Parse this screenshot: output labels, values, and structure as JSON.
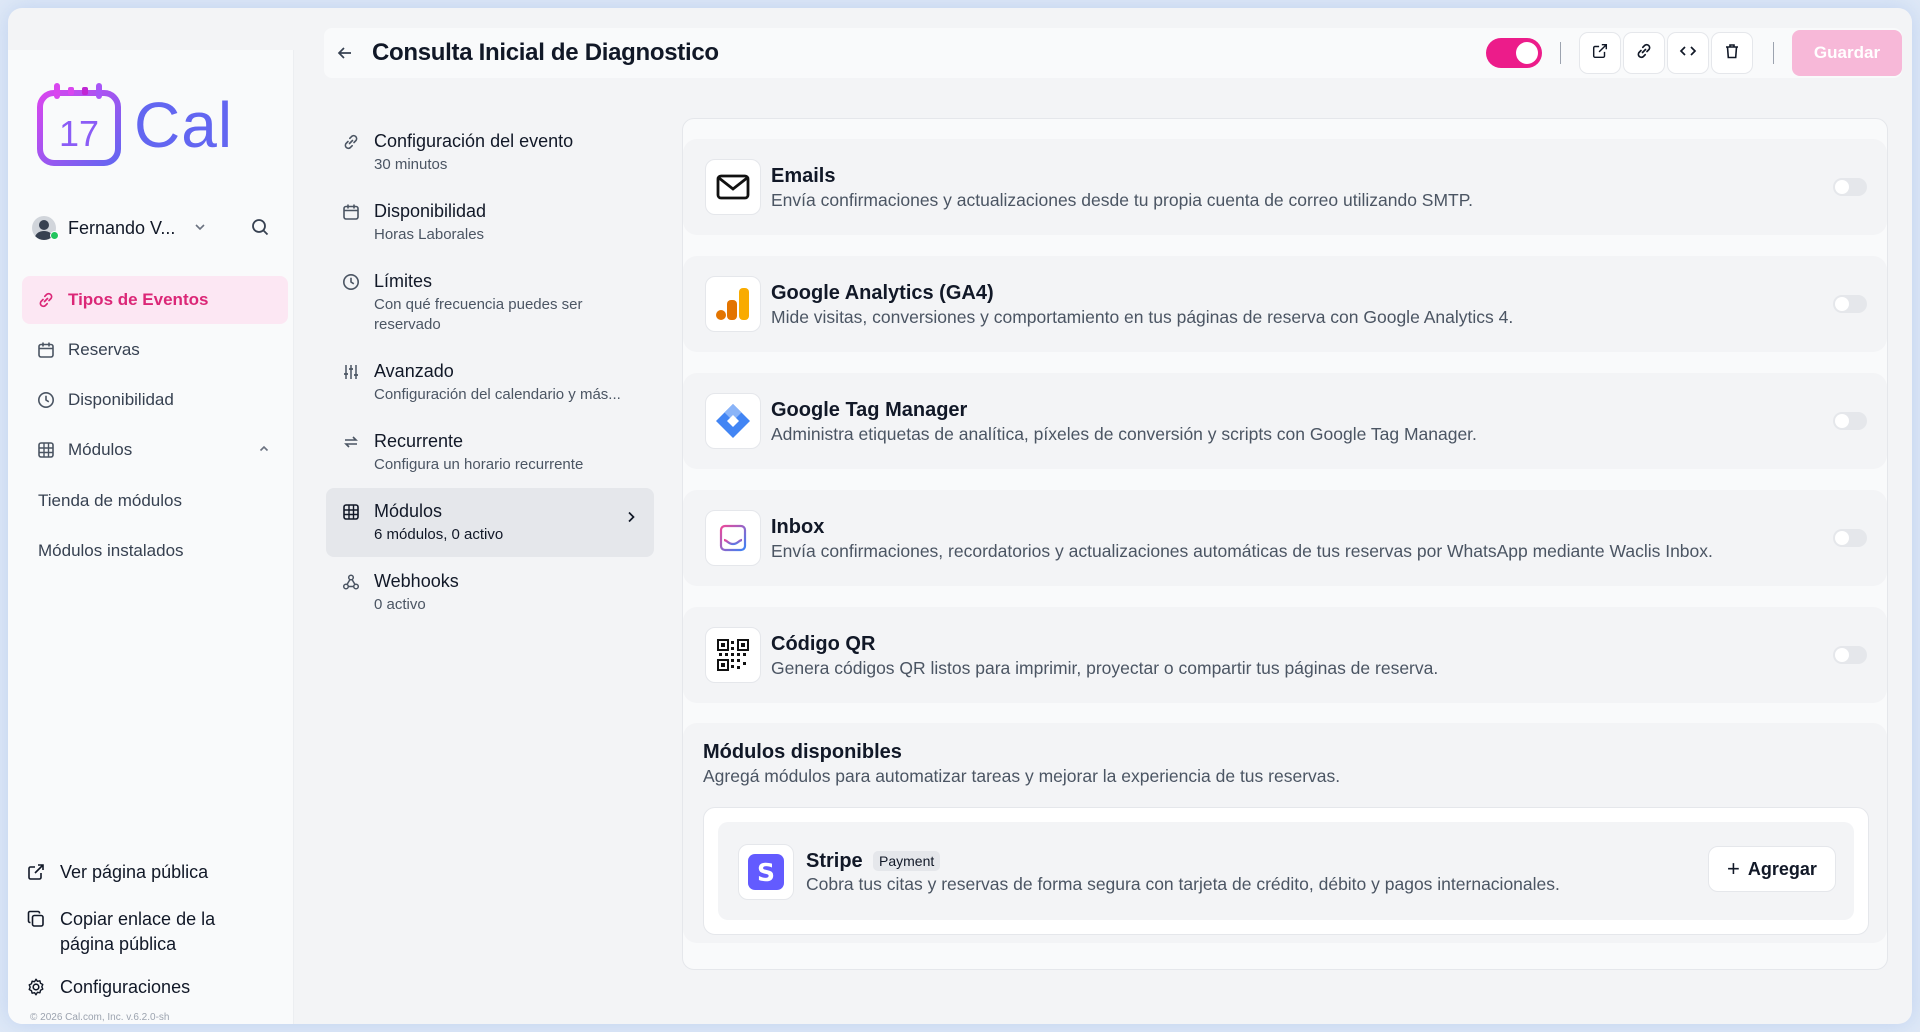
{
  "app": {
    "logo_text": "Cal",
    "logo_day": "17"
  },
  "user": {
    "name": "Fernando V..."
  },
  "sidebar": {
    "items": [
      {
        "label": "Tipos de Eventos",
        "icon": "link-icon",
        "active": true
      },
      {
        "label": "Reservas",
        "icon": "calendar-icon"
      },
      {
        "label": "Disponibilidad",
        "icon": "clock-icon"
      },
      {
        "label": "Módulos",
        "icon": "grid-icon"
      }
    ],
    "sub_items": [
      "Tienda de módulos",
      "Módulos instalados"
    ],
    "bottom": [
      {
        "label": "Ver página pública",
        "icon": "external-link-icon"
      },
      {
        "label": "Copiar enlace de la página pública",
        "icon": "copy-icon"
      },
      {
        "label": "Configuraciones",
        "icon": "gear-icon"
      }
    ],
    "copyright": "© 2026 Cal.com, Inc. v.6.2.0-sh"
  },
  "header": {
    "title": "Consulta Inicial de Diagnostico",
    "save_label": "Guardar",
    "event_enabled": true
  },
  "subnav": [
    {
      "title": "Configuración del evento",
      "desc": "30 minutos",
      "icon": "link-icon"
    },
    {
      "title": "Disponibilidad",
      "desc": "Horas Laborales",
      "icon": "calendar-icon"
    },
    {
      "title": "Límites",
      "desc": "Con qué frecuencia puedes ser reservado",
      "icon": "clock-icon"
    },
    {
      "title": "Avanzado",
      "desc": "Configuración del calendario y más...",
      "icon": "sliders-icon"
    },
    {
      "title": "Recurrente",
      "desc": "Configura un horario recurrente",
      "icon": "repeat-icon"
    },
    {
      "title": "Módulos",
      "desc": "6 módulos, 0 activo",
      "icon": "grid-icon",
      "active": true
    },
    {
      "title": "Webhooks",
      "desc": "0 activo",
      "icon": "webhook-icon"
    }
  ],
  "modules": [
    {
      "name": "Emails",
      "desc": "Envía confirmaciones y actualizaciones desde tu propia cuenta de correo utilizando SMTP.",
      "icon": "mail-icon",
      "enabled": false
    },
    {
      "name": "Google Analytics (GA4)",
      "desc": "Mide visitas, conversiones y comportamiento en tus páginas de reserva con Google Analytics 4.",
      "icon": "google-analytics-icon",
      "enabled": false
    },
    {
      "name": "Google Tag Manager",
      "desc": "Administra etiquetas de analítica, píxeles de conversión y scripts con Google Tag Manager.",
      "icon": "google-tag-manager-icon",
      "enabled": false
    },
    {
      "name": "Inbox",
      "desc": "Envía confirmaciones, recordatorios y actualizaciones automáticas de tus reservas por WhatsApp mediante Waclis Inbox.",
      "icon": "inbox-icon",
      "enabled": false
    },
    {
      "name": "Código QR",
      "desc": "Genera códigos QR listos para imprimir, proyectar o compartir tus páginas de reserva.",
      "icon": "qr-code-icon",
      "enabled": false
    }
  ],
  "available": {
    "title": "Módulos disponibles",
    "desc": "Agregá módulos para automatizar tareas y mejorar la experiencia de tus reservas.",
    "items": [
      {
        "name": "Stripe",
        "badge": "Payment",
        "desc": "Cobra tus citas y reservas de forma segura con tarjeta de crédito, débito y pagos internacionales.",
        "action": "Agregar",
        "icon": "stripe-icon"
      }
    ]
  },
  "colors": {
    "brand": "#ec1c8a",
    "accent_nav": "#db2777",
    "stripe": "#635bff"
  }
}
